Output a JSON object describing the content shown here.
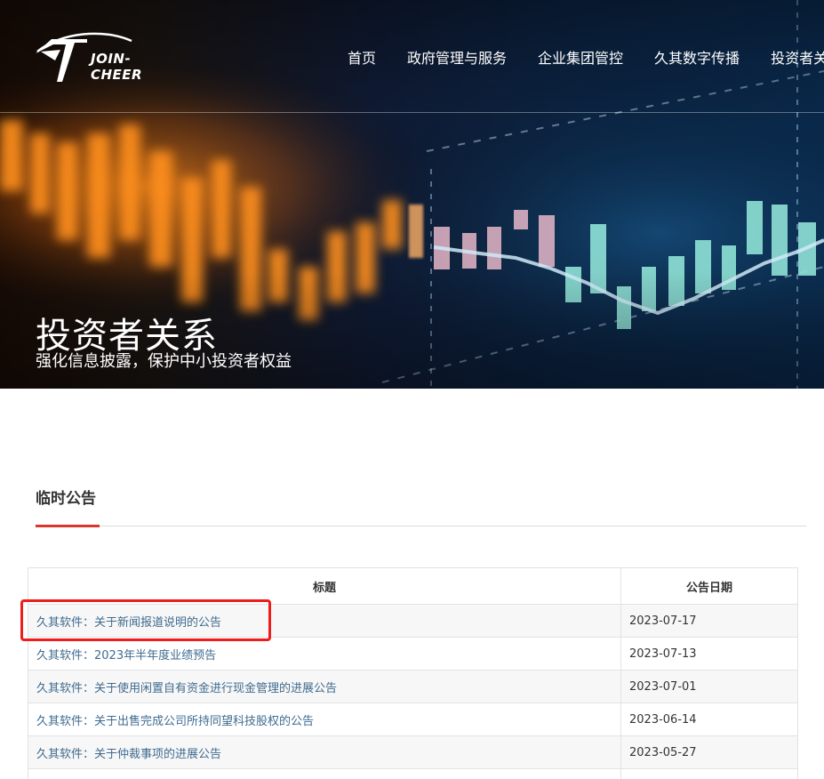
{
  "header": {
    "logo_text": "JOIN-CHEER",
    "nav": [
      {
        "label": "首页"
      },
      {
        "label": "政府管理与服务"
      },
      {
        "label": "企业集团管控"
      },
      {
        "label": "久其数字传播"
      },
      {
        "label": "投资者关"
      }
    ]
  },
  "hero": {
    "title": "投资者关系",
    "subtitle": "强化信息披露，保护中小投资者权益"
  },
  "section": {
    "title": "临时公告"
  },
  "table": {
    "headers": {
      "title": "标题",
      "date": "公告日期"
    },
    "rows": [
      {
        "title": "久其软件：关于新闻报道说明的公告",
        "date": "2023-07-17"
      },
      {
        "title": "久其软件：2023年半年度业绩预告",
        "date": "2023-07-13"
      },
      {
        "title": "久其软件：关于使用闲置自有资金进行现金管理的进展公告",
        "date": "2023-07-01"
      },
      {
        "title": "久其软件：关于出售完成公司所持同望科技股权的公告",
        "date": "2023-06-14"
      },
      {
        "title": "久其软件：关于仲裁事项的进展公告",
        "date": "2023-05-27"
      },
      {
        "title": "",
        "date": ""
      }
    ]
  },
  "colors": {
    "accent": "#d9362c",
    "link": "#3f6b8f",
    "highlight_box": "#ee1c1c"
  }
}
